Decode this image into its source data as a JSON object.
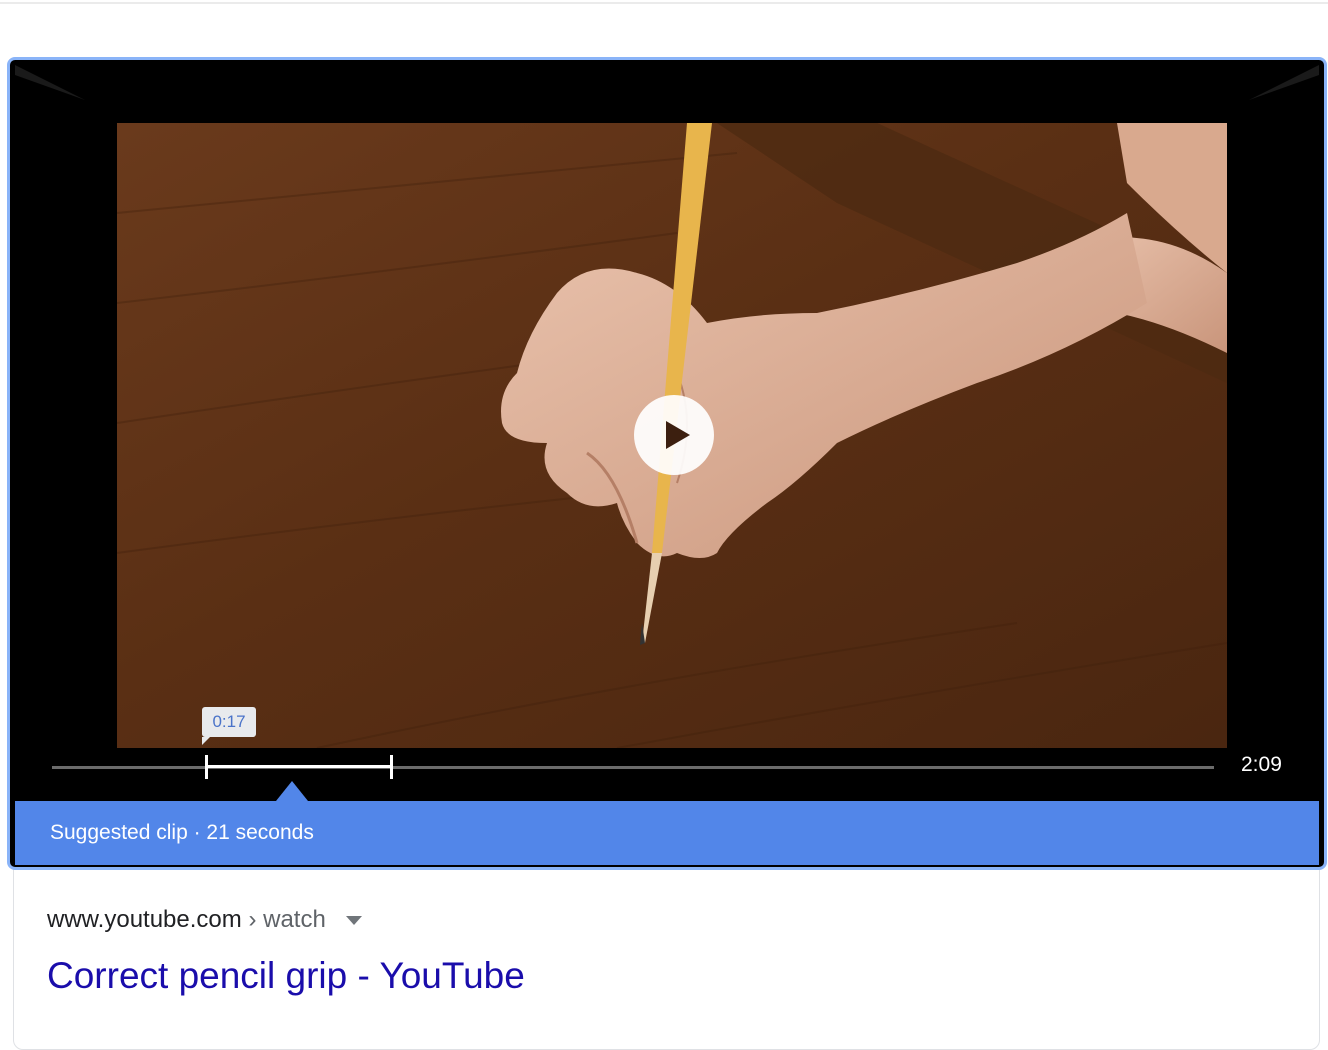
{
  "video": {
    "tooltip_time": "0:17",
    "duration": "2:09",
    "play_icon": "play-icon",
    "clip_start_fraction": 0.132,
    "clip_end_fraction": 0.292
  },
  "clip": {
    "label": "Suggested clip · 21 seconds"
  },
  "result": {
    "domain": "www.youtube.com",
    "separator": "›",
    "path": "watch",
    "title": "Correct pencil grip - YouTube"
  },
  "colors": {
    "accent_blue": "#5286e9",
    "frame_border": "#8ab4f8",
    "link_color": "#1a0dab"
  }
}
